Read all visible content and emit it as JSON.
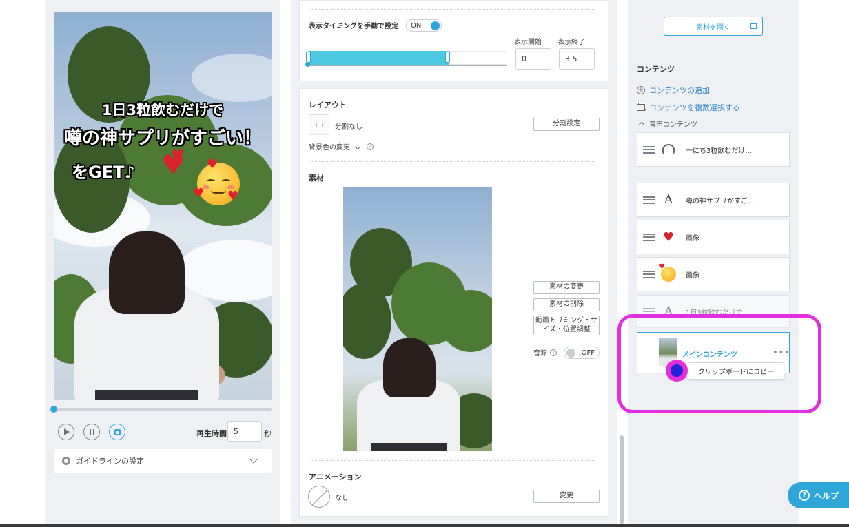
{
  "preview": {
    "caption_line1": "1日3粒飲むだけで",
    "caption_line2": "噂の神サプリがすごい！",
    "caption_line3": "をGET♪",
    "playtime_label": "再生時間",
    "playtime_value": "5",
    "playtime_unit": "秒",
    "guideline_label": "ガイドラインの設定",
    "progress": 0
  },
  "timing": {
    "label": "表示タイミングを手動で設定",
    "toggle_value": "ON",
    "start_label": "表示開始",
    "end_label": "表示終了",
    "start_value": "0",
    "end_value": "3.5"
  },
  "layout": {
    "heading": "レイアウト",
    "split_label": "分割なし",
    "split_button": "分割設定",
    "bg_color_label": "背景色の変更"
  },
  "material": {
    "heading": "素材",
    "change_button": "素材の変更",
    "delete_button": "素材の削除",
    "trim_button_line1": "動画トリミング・サ",
    "trim_button_line2": "イズ・位置調整",
    "audio_label": "音源",
    "audio_toggle": "OFF"
  },
  "animation": {
    "heading": "アニメーション",
    "value": "なし",
    "change_button": "変更"
  },
  "sidebar": {
    "open_material_button": "素材を開く",
    "contents_title": "コンテンツ",
    "add_content": "コンテンツの追加",
    "multi_select": "コンテンツを複数選択する",
    "audio_section": "音声コンテンツ",
    "items": [
      {
        "icon": "audio-icon",
        "label": "一にち3粒飲むだけ..."
      },
      {
        "icon": "text-icon",
        "label": "噂の神サプリがすご..."
      },
      {
        "icon": "heart-icon",
        "label": "画像"
      },
      {
        "icon": "smiley-icon",
        "label": "画像"
      },
      {
        "icon": "text-icon",
        "label": "1日3粒飲むだけで"
      }
    ],
    "main_content_label": "メインコンテンツ",
    "copy_tooltip": "クリップボードにコピー"
  },
  "help": {
    "label": "ヘルプ"
  },
  "colors": {
    "accent": "#2ea7d8",
    "highlight": "#e12fe0",
    "slider_fill": "#4cc8e0"
  }
}
